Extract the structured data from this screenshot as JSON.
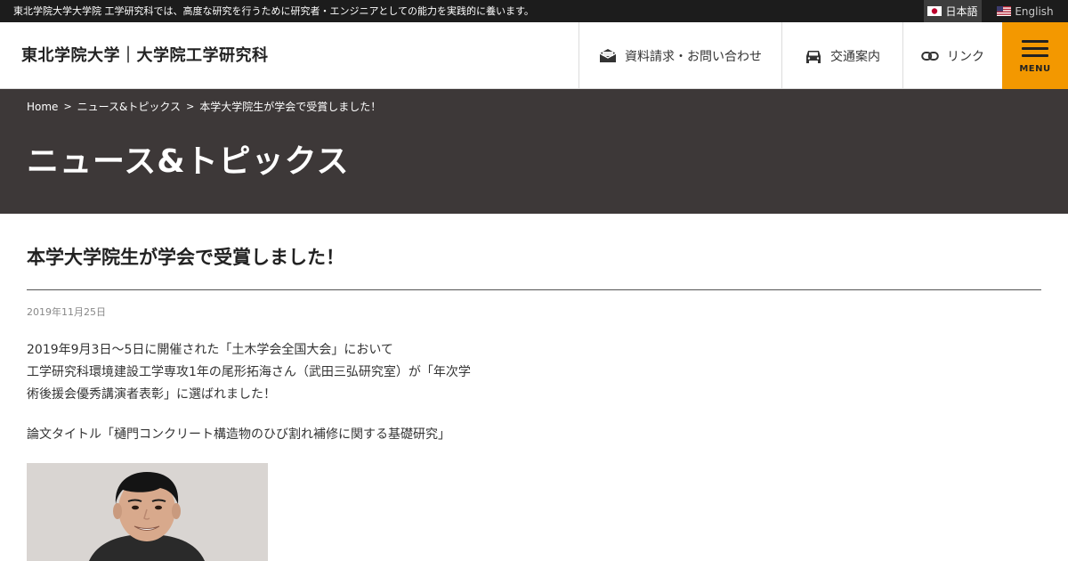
{
  "topbar": {
    "tagline": "東北学院大学大学院 工学研究科では、高度な研究を行うために研究者・エンジニアとしての能力を実践的に養います。",
    "lang_ja": "日本語",
    "lang_en": "English",
    "flag_ja_icon": "japan-flag-icon",
    "flag_en_icon": "us-flag-icon"
  },
  "header": {
    "site_title": "東北学院大学｜大学院工学研究科",
    "nav": [
      {
        "label": "資料請求・お問い合わせ",
        "icon": "envelope-icon"
      },
      {
        "label": "交通案内",
        "icon": "car-icon"
      },
      {
        "label": "リンク",
        "icon": "link-icon"
      }
    ],
    "menu_label": "MENU",
    "menu_color": "#f39800"
  },
  "hero": {
    "breadcrumb": [
      "Home",
      "ニュース&トピックス",
      "本学大学院生が学会で受賞しました！"
    ],
    "breadcrumb_sep": ">",
    "title": "ニュース&トピックス",
    "background": "#3d3838"
  },
  "article": {
    "title": "本学大学院生が学会で受賞しました！",
    "date": "2019年11月25日",
    "body_lines": [
      "2019年9月3日～5日に開催された「土木学会全国大会」において",
      "工学研究科環境建設工学専攻1年の尾形拓海さん（武田三弘研究室）が「年次学",
      "術後援会優秀講演者表彰」に選ばれました！"
    ],
    "paper_title": "論文タイトル「樋門コンクリート構造物のひび割れ補修に関する基礎研究」",
    "photo_icon": "student-photo"
  }
}
